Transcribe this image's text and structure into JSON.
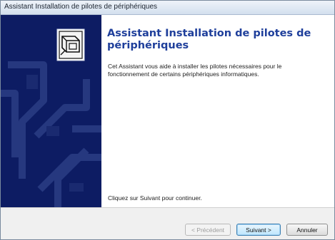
{
  "window": {
    "title": "Assistant Installation de pilotes de périphériques"
  },
  "main": {
    "heading": "Assistant Installation de pilotes de périphériques",
    "description": "Cet Assistant vous aide à installer les pilotes nécessaires pour le fonctionnement de certains périphériques informatiques.",
    "continue_text": "Cliquez sur Suivant pour continuer."
  },
  "buttons": {
    "previous": "< Précédent",
    "next": "Suivant >",
    "cancel": "Annuler"
  },
  "icons": {
    "banner": "device-driver-icon"
  },
  "colors": {
    "banner_bg": "#0d1c63",
    "heading": "#1f3f9b"
  }
}
